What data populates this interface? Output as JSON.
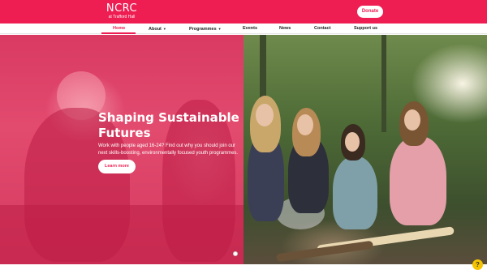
{
  "header": {
    "logo_main": "NCRC",
    "logo_sub": "at Trafford Hall",
    "donate_label": "Donate"
  },
  "nav": {
    "items": [
      {
        "label": "Home",
        "has_dropdown": false,
        "active": true
      },
      {
        "label": "About",
        "has_dropdown": true,
        "active": false
      },
      {
        "label": "Programmes",
        "has_dropdown": true,
        "active": false
      },
      {
        "label": "Events",
        "has_dropdown": false,
        "active": false
      },
      {
        "label": "News",
        "has_dropdown": false,
        "active": false
      },
      {
        "label": "Contact",
        "has_dropdown": false,
        "active": false
      },
      {
        "label": "Support us",
        "has_dropdown": false,
        "active": false
      }
    ],
    "caret_glyph": "▼"
  },
  "hero": {
    "title": "Shaping Sustainable Futures",
    "text": "Work with people aged 16-24? Find out why you should join our next skills-boosting, environmentally focused youth programmes.",
    "cta_label": "Learn more"
  },
  "help": {
    "icon": "accessibility-help-icon",
    "glyph": "?"
  },
  "colors": {
    "brand": "#ee1d52",
    "help": "#f5c400"
  }
}
